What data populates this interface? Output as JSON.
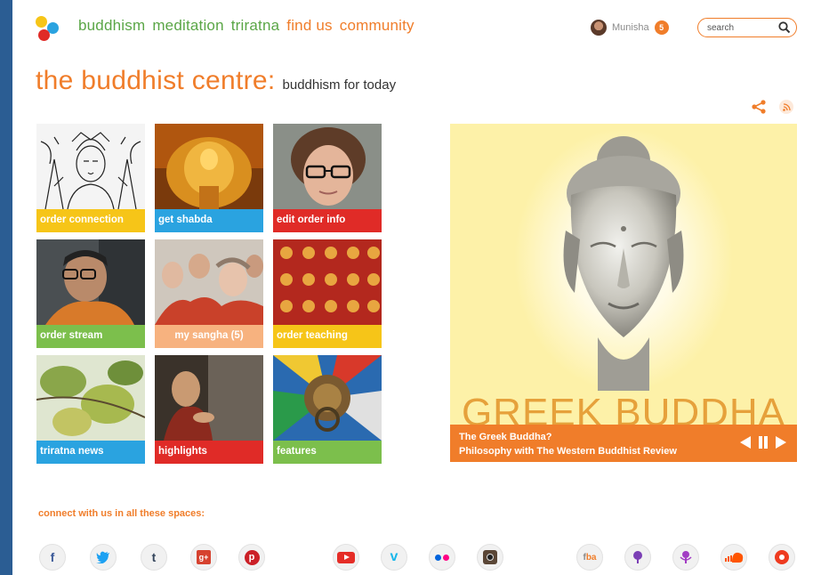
{
  "nav": {
    "items": [
      {
        "label": "buddhism",
        "color": "#5aa646"
      },
      {
        "label": "meditation",
        "color": "#5aa646"
      },
      {
        "label": "triratna",
        "color": "#5aa646"
      },
      {
        "label": "find us",
        "color": "#f07d2a"
      },
      {
        "label": "community",
        "color": "#f07d2a"
      }
    ]
  },
  "user": {
    "name": "Munisha",
    "notifications": "5"
  },
  "search": {
    "placeholder": "search"
  },
  "header": {
    "title": "the buddhist centre:",
    "subtitle": "buddhism for today"
  },
  "tiles": [
    {
      "label": "order connection",
      "color": "yellow"
    },
    {
      "label": "get shabda",
      "color": "blue"
    },
    {
      "label": "edit order info",
      "color": "red"
    },
    {
      "label": "order stream",
      "color": "green"
    },
    {
      "label": "my sangha (5)",
      "color": "peach"
    },
    {
      "label": "order teaching",
      "color": "yellow"
    },
    {
      "label": "triratna news",
      "color": "blue"
    },
    {
      "label": "highlights",
      "color": "red"
    },
    {
      "label": "features",
      "color": "green"
    }
  ],
  "feature": {
    "banner_text": "GREEK BUDDHA",
    "caption_title": "The Greek Buddha?",
    "caption_subtitle": "Philosophy with The Western Buddhist Review"
  },
  "footer": {
    "connect_label": "connect with us in all these spaces:",
    "social": [
      "facebook",
      "twitter",
      "tumblr",
      "google-plus",
      "pinterest",
      "youtube",
      "vimeo",
      "flickr",
      "instagram",
      "fba",
      "podcast",
      "audio",
      "soundcloud",
      "other"
    ]
  },
  "colors": {
    "accent_orange": "#f07d2a",
    "accent_green": "#5aa646",
    "page_bg": "#2b5d93"
  }
}
